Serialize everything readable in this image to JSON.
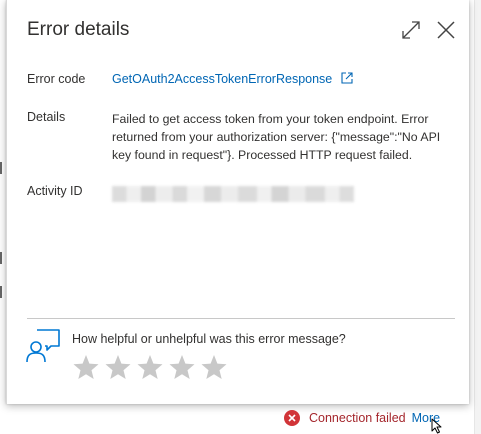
{
  "dialog": {
    "title": "Error details",
    "fields": {
      "error_code": {
        "label": "Error code",
        "value": "GetOAuth2AccessTokenErrorResponse"
      },
      "details": {
        "label": "Details",
        "value": "Failed to get access token from your token endpoint. Error returned from your authorization server: {\"message\":\"No API key found in request\"}. Processed HTTP request failed."
      },
      "activity_id": {
        "label": "Activity ID"
      }
    },
    "feedback": {
      "question": "How helpful or unhelpful was this error message?",
      "stars_total": 5,
      "stars_selected": 0
    }
  },
  "status_bar": {
    "message": "Connection failed",
    "more_label": "More"
  },
  "colors": {
    "link": "#0066b4",
    "error_red": "#d13438",
    "star_empty": "#c8c8c8",
    "feedback_icon": "#0078d4"
  },
  "icons": {
    "expand": "expand-icon",
    "close": "close-icon",
    "external_link": "external-link-icon",
    "feedback": "feedback-person-icon",
    "error": "error-circle-icon",
    "cursor": "mouse-cursor-icon"
  }
}
